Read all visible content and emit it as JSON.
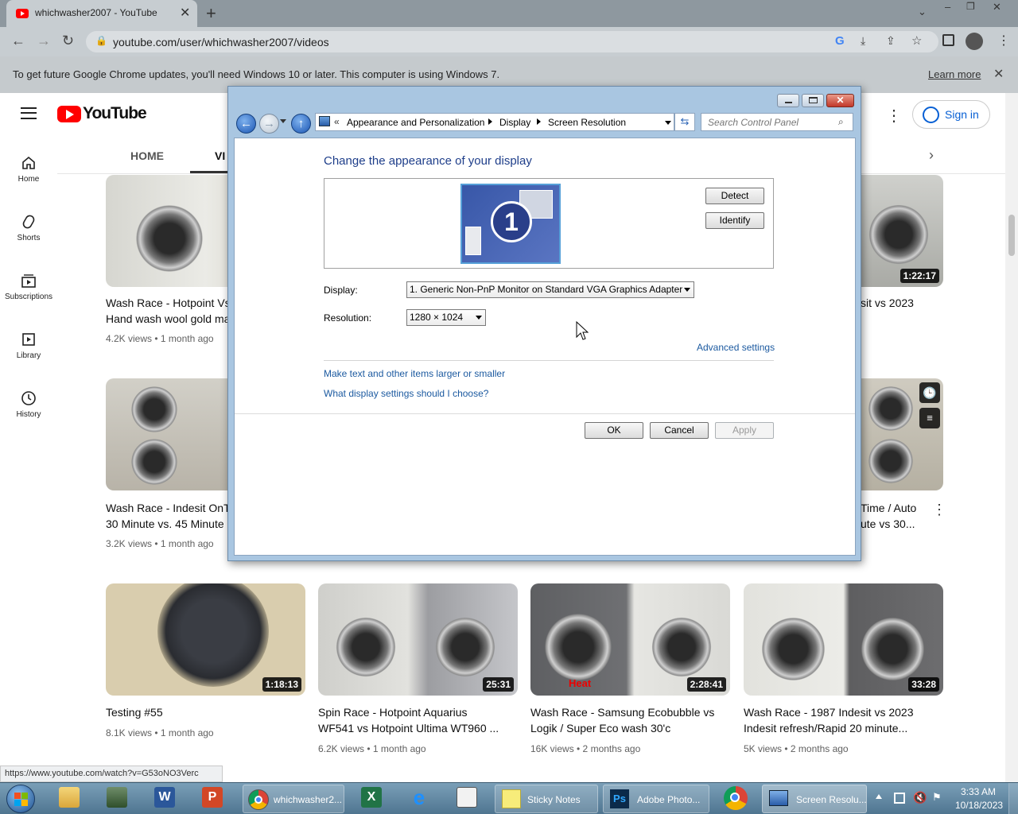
{
  "browser": {
    "tab_title": "whichwasher2007 - YouTube",
    "url": "youtube.com/user/whichwasher2007/videos",
    "infobar_text": "To get future Google Chrome updates, you'll need Windows 10 or later. This computer is using Windows 7.",
    "infobar_link": "Learn more",
    "status_url": "https://www.youtube.com/watch?v=G53oNO3Verc"
  },
  "youtube": {
    "logo_text": "YouTube",
    "sign_in": "Sign in",
    "tabs": [
      "HOME",
      "VI"
    ],
    "sidebar": [
      {
        "label": "Home",
        "icon": "home-icon"
      },
      {
        "label": "Shorts",
        "icon": "shorts-icon"
      },
      {
        "label": "Subscriptions",
        "icon": "subscriptions-icon"
      },
      {
        "label": "Library",
        "icon": "library-icon"
      },
      {
        "label": "History",
        "icon": "history-icon"
      }
    ],
    "videos_row1": [
      {
        "title": "Wash Race - Hotpoint Vs",
        "title2": "Hand wash wool gold ma",
        "meta": "4.2K views • 1 month ago"
      },
      {
        "partial_title": "sit vs 2023",
        "duration": "1:22:17"
      }
    ],
    "videos_row2": [
      {
        "title": "Wash Race - Indesit OnT",
        "title2": "30 Minute vs. 45 Minute",
        "meta": "3.2K views • 1 month ago"
      },
      {
        "partial_title": "Time / Auto",
        "partial_title2": "ute vs 30..."
      }
    ],
    "videos_row3": [
      {
        "title": "Testing #55",
        "title2": "",
        "meta": "8.1K views • 1 month ago",
        "duration": "1:18:13"
      },
      {
        "title": "Spin Race - Hotpoint Aquarius",
        "title2": "WF541 vs Hotpoint Ultima WT960 ...",
        "meta": "6.2K views • 1 month ago",
        "duration": "25:31"
      },
      {
        "title": "Wash Race - Samsung Ecobubble vs",
        "title2": "Logik / Super Eco wash 30'c",
        "meta": "16K views • 2 months ago",
        "duration": "2:28:41",
        "overlay": "Heat"
      },
      {
        "title": "Wash Race - 1987 Indesit vs 2023",
        "title2": "Indesit refresh/Rapid 20 minute...",
        "meta": "5K views • 2 months ago",
        "duration": "33:28"
      }
    ]
  },
  "dialog": {
    "breadcrumb": [
      "Appearance and Personalization",
      "Display",
      "Screen Resolution"
    ],
    "search_placeholder": "Search Control Panel",
    "heading": "Change the appearance of your display",
    "monitor_number": "1",
    "detect": "Detect",
    "identify": "Identify",
    "display_label": "Display:",
    "display_value": "1. Generic Non-PnP Monitor on Standard VGA Graphics Adapter",
    "resolution_label": "Resolution:",
    "resolution_value": "1280 × 1024",
    "advanced": "Advanced settings",
    "link1": "Make text and other items larger or smaller",
    "link2": "What display settings should I choose?",
    "ok": "OK",
    "cancel": "Cancel",
    "apply": "Apply"
  },
  "taskbar": {
    "items": [
      "whichwasher2...",
      "Sticky Notes",
      "Adobe Photo...",
      "Screen Resolu..."
    ],
    "time": "3:33 AM",
    "date": "10/18/2023"
  }
}
